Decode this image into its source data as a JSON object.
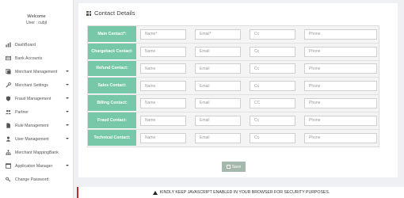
{
  "sidebar": {
    "welcome": "Welcome",
    "user": "User : cubjl",
    "items": [
      {
        "label": "DashBoard",
        "icon": "bar-chart-icon",
        "caret": false
      },
      {
        "label": "Bank Accounts",
        "icon": "card-icon",
        "caret": false
      },
      {
        "label": "Merchant Management",
        "icon": "document-icon",
        "caret": true
      },
      {
        "label": "Merchant Settings",
        "icon": "wrench-icon",
        "caret": true
      },
      {
        "label": "Fraud Management",
        "icon": "shield-icon",
        "caret": true
      },
      {
        "label": "Partner",
        "icon": "users-icon",
        "caret": true
      },
      {
        "label": "Rule Management",
        "icon": "file-icon",
        "caret": true
      },
      {
        "label": "User Management",
        "icon": "user-icon",
        "caret": true
      },
      {
        "label": "Merchant MappingBank",
        "icon": "sitemap-icon",
        "caret": false
      },
      {
        "label": "Application Manager",
        "icon": "window-icon",
        "caret": true
      },
      {
        "label": "Change Password",
        "icon": "key-icon",
        "caret": false
      }
    ]
  },
  "main": {
    "title": "Contact Details",
    "rows": [
      {
        "label": "Main Contact*:",
        "name": "Name*",
        "email": "Email*",
        "cc": "Cc",
        "phone": "Phone"
      },
      {
        "label": "Chargeback Contact:",
        "name": "Name",
        "email": "Email",
        "cc": "Cc",
        "phone": "Phone"
      },
      {
        "label": "Refund Contact:",
        "name": "Name",
        "email": "Email",
        "cc": "Cc",
        "phone": "Phone"
      },
      {
        "label": "Sales Contact:",
        "name": "Name",
        "email": "Email",
        "cc": "Cc",
        "phone": "Phone"
      },
      {
        "label": "Billing Contact:",
        "name": "Name",
        "email": "Email",
        "cc": "CC",
        "phone": "Phone"
      },
      {
        "label": "Fraud Contact:",
        "name": "Name",
        "email": "Email",
        "cc": "Cc",
        "phone": "Phone"
      },
      {
        "label": "Technical Contact:",
        "name": "Name",
        "email": "Email",
        "cc": "Cc",
        "phone": "Phone"
      }
    ],
    "save_label": "Save"
  },
  "notice": "KINDLY KEEP JAVASCRIPT ENABLED IN YOUR BROWSER FOR SECURITY PURPOSES.",
  "colors": {
    "label_bg": "#76c8a8",
    "save_bg": "#a4b8ac",
    "notice_border": "#c62828"
  }
}
